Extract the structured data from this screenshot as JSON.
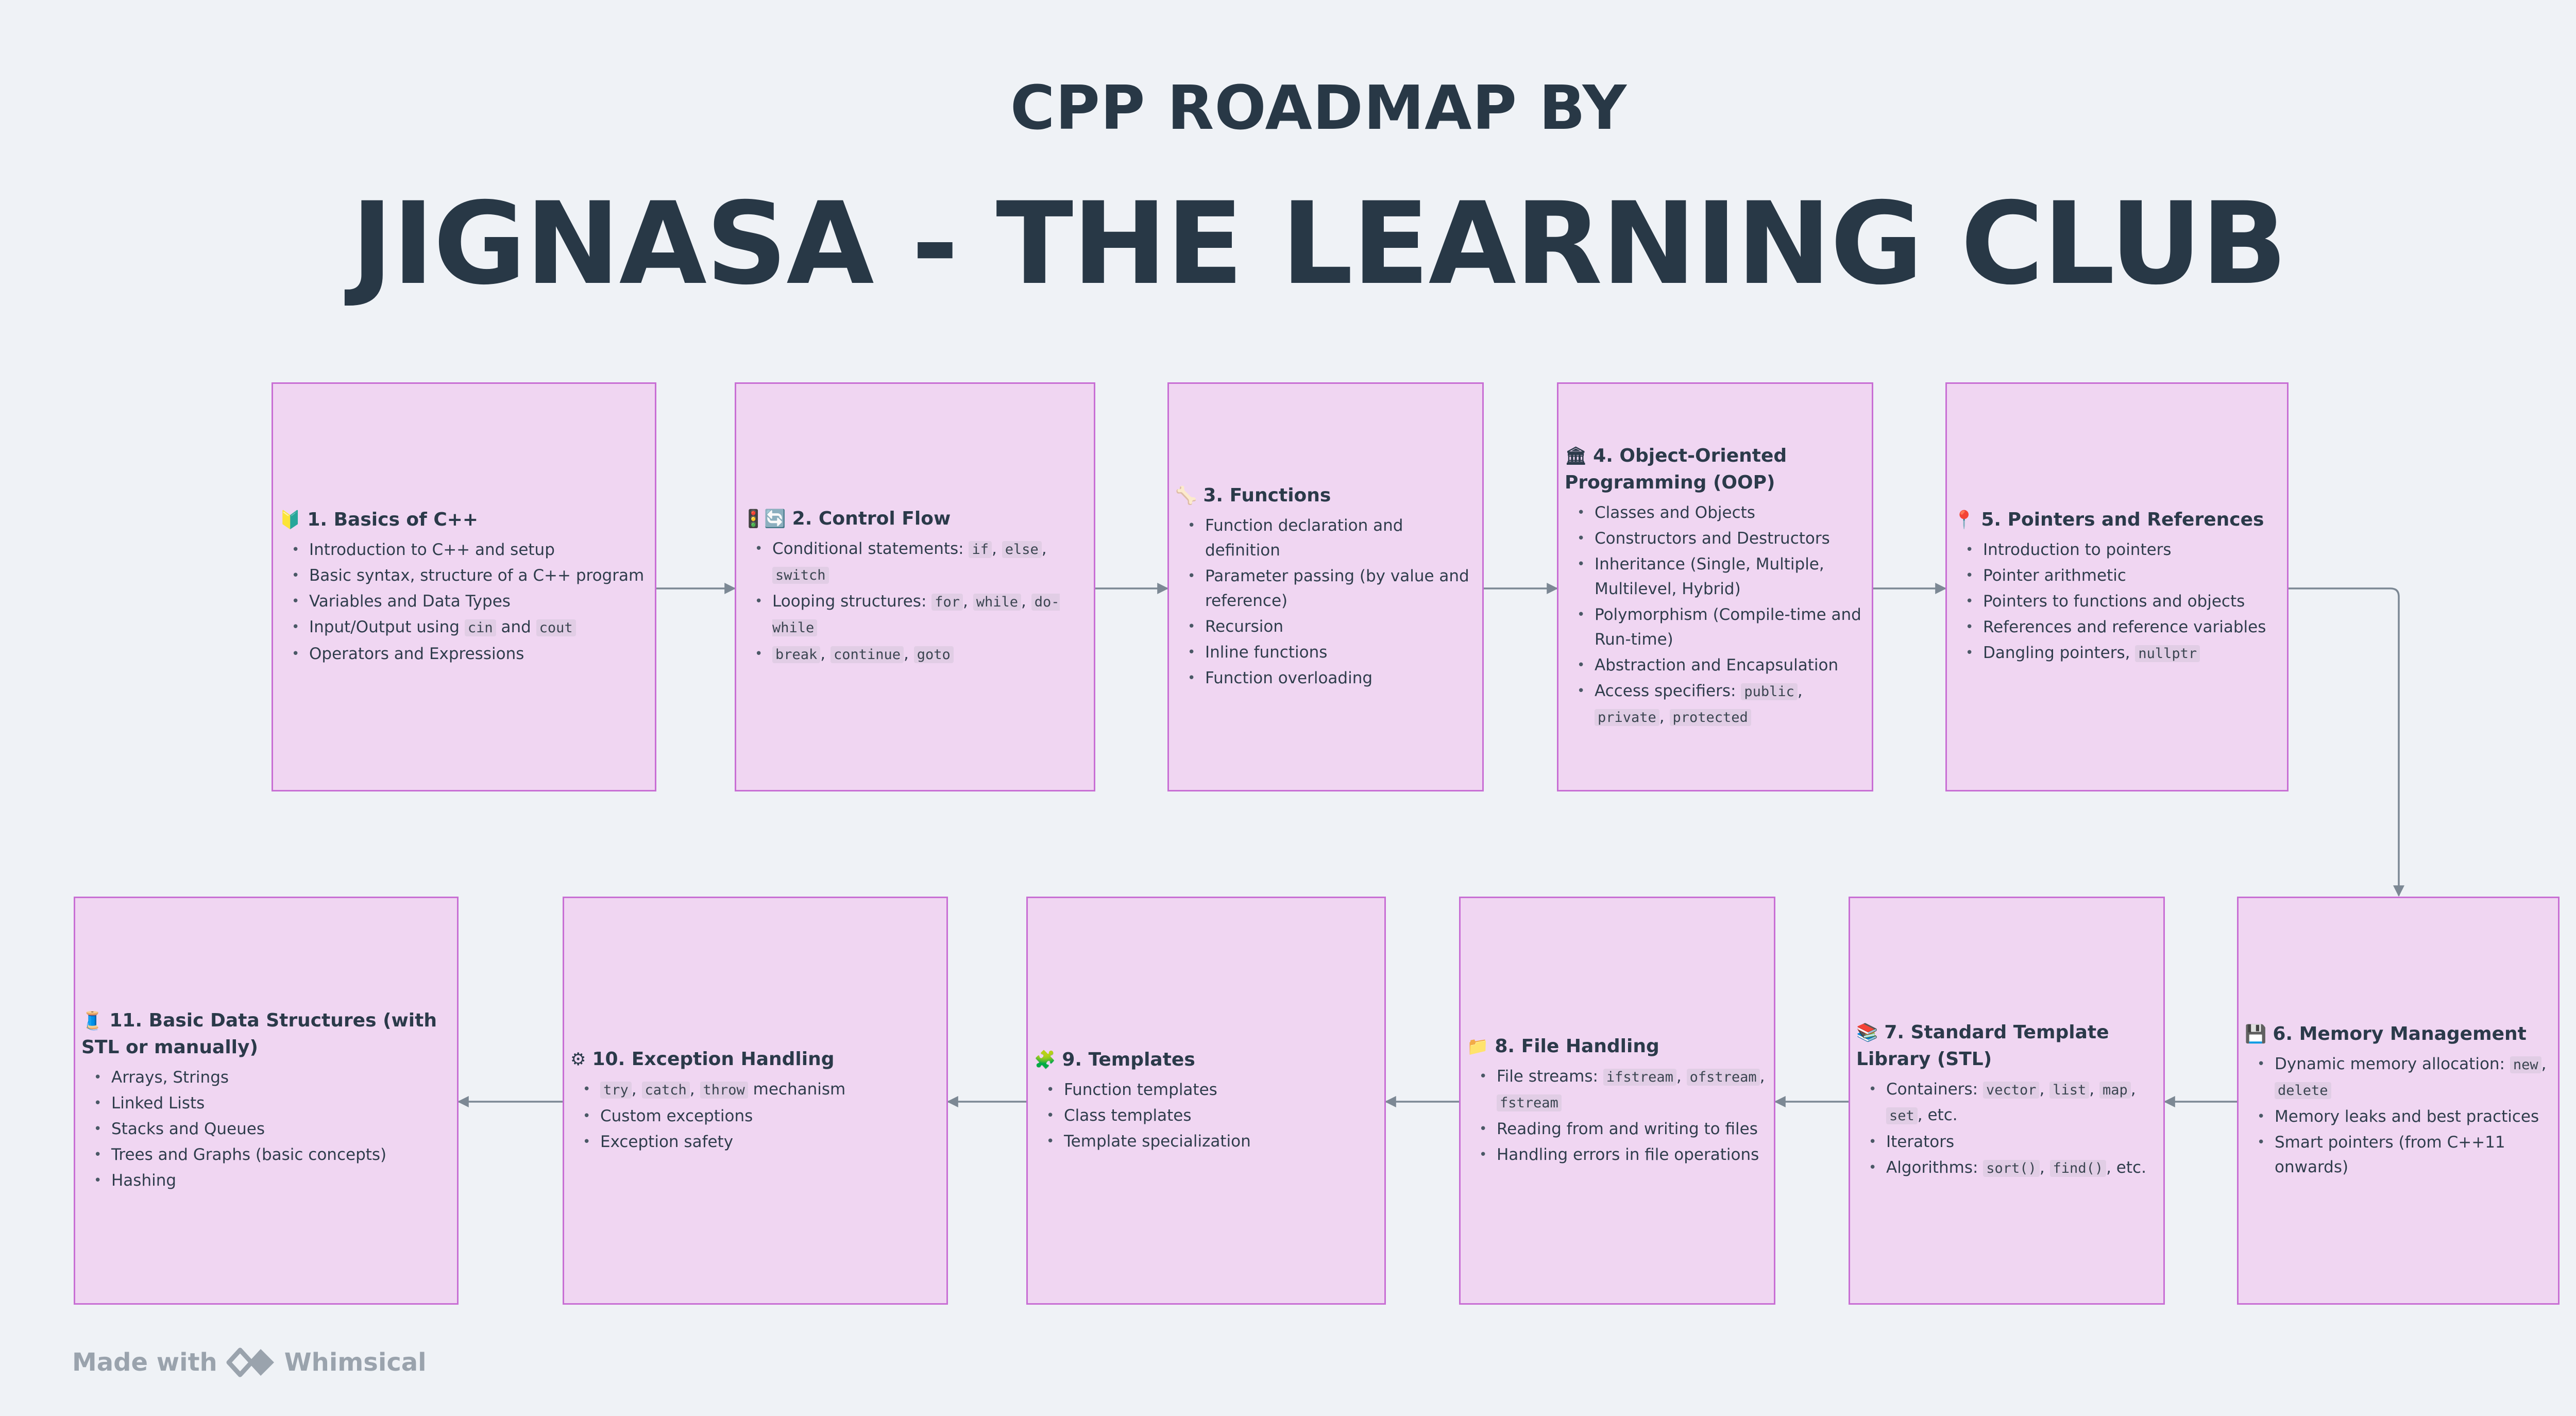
{
  "header": {
    "line1": "CPP ROADMAP BY",
    "line2": "JIGNASA - THE LEARNING CLUB"
  },
  "colors": {
    "box_fill": "#f0d6f2",
    "box_border": "#c86fd4",
    "arrow": "#7c8894",
    "title": "#283846"
  },
  "boxes": [
    {
      "title": "1. Basics of C++",
      "icon": "beginner-icon",
      "glyph": "🔰",
      "items": [
        [
          {
            "t": "Introduction to C++ and setup"
          }
        ],
        [
          {
            "t": "Basic syntax, structure of a C++ program"
          }
        ],
        [
          {
            "t": "Variables and Data Types"
          }
        ],
        [
          {
            "t": "Input/Output using "
          },
          {
            "c": "cin"
          },
          {
            "t": " and "
          },
          {
            "c": "cout"
          }
        ],
        [
          {
            "t": "Operators and Expressions"
          }
        ]
      ]
    },
    {
      "title": "2. Control Flow",
      "icon": "control-flow-icon",
      "glyph": "🚦🔄",
      "items": [
        [
          {
            "t": "Conditional statements: "
          },
          {
            "c": "if"
          },
          {
            "t": ", "
          },
          {
            "c": "else"
          },
          {
            "t": ", "
          },
          {
            "c": "switch"
          }
        ],
        [
          {
            "t": "Looping structures: "
          },
          {
            "c": "for"
          },
          {
            "t": ", "
          },
          {
            "c": "while"
          },
          {
            "t": ", "
          },
          {
            "c": "do-while"
          }
        ],
        [
          {
            "c": "break"
          },
          {
            "t": ", "
          },
          {
            "c": "continue"
          },
          {
            "t": ", "
          },
          {
            "c": "goto"
          }
        ]
      ]
    },
    {
      "title": "3. Functions",
      "icon": "bone-icon",
      "glyph": "🦴",
      "items": [
        [
          {
            "t": "Function declaration and definition"
          }
        ],
        [
          {
            "t": "Parameter passing (by value and reference)"
          }
        ],
        [
          {
            "t": "Recursion"
          }
        ],
        [
          {
            "t": "Inline functions"
          }
        ],
        [
          {
            "t": "Function overloading"
          }
        ]
      ]
    },
    {
      "title": "4. Object-Oriented Programming (OOP)",
      "icon": "classical-building-icon",
      "glyph": "🏛",
      "items": [
        [
          {
            "t": "Classes and Objects"
          }
        ],
        [
          {
            "t": "Constructors and Destructors"
          }
        ],
        [
          {
            "t": "Inheritance (Single, Multiple, Multilevel, Hybrid)"
          }
        ],
        [
          {
            "t": "Polymorphism (Compile-time and Run-time)"
          }
        ],
        [
          {
            "t": "Abstraction and Encapsulation"
          }
        ],
        [
          {
            "t": "Access specifiers: "
          },
          {
            "c": "public"
          },
          {
            "t": ", "
          },
          {
            "c": "private"
          },
          {
            "t": ", "
          },
          {
            "c": "protected"
          }
        ]
      ]
    },
    {
      "title": "5. Pointers and References",
      "icon": "pushpin-icon",
      "glyph": "📍",
      "items": [
        [
          {
            "t": "Introduction to pointers"
          }
        ],
        [
          {
            "t": "Pointer arithmetic"
          }
        ],
        [
          {
            "t": "Pointers to functions and objects"
          }
        ],
        [
          {
            "t": "References and reference variables"
          }
        ],
        [
          {
            "t": "Dangling pointers, "
          },
          {
            "c": "nullptr"
          }
        ]
      ]
    },
    {
      "title": "6. Memory Management",
      "icon": "floppy-disk-icon",
      "glyph": "💾",
      "items": [
        [
          {
            "t": "Dynamic memory allocation: "
          },
          {
            "c": "new"
          },
          {
            "t": ", "
          },
          {
            "c": "delete"
          }
        ],
        [
          {
            "t": "Memory leaks and best practices"
          }
        ],
        [
          {
            "t": "Smart pointers (from C++11 onwards)"
          }
        ]
      ]
    },
    {
      "title": "7. Standard Template Library (STL)",
      "icon": "books-icon",
      "glyph": "📚",
      "items": [
        [
          {
            "t": "Containers: "
          },
          {
            "c": "vector"
          },
          {
            "t": ", "
          },
          {
            "c": "list"
          },
          {
            "t": ", "
          },
          {
            "c": "map"
          },
          {
            "t": ", "
          },
          {
            "c": "set"
          },
          {
            "t": ", etc."
          }
        ],
        [
          {
            "t": "Iterators"
          }
        ],
        [
          {
            "t": "Algorithms: "
          },
          {
            "c": "sort()"
          },
          {
            "t": ", "
          },
          {
            "c": "find()"
          },
          {
            "t": ", etc."
          }
        ]
      ]
    },
    {
      "title": "8. File Handling",
      "icon": "folder-icon",
      "glyph": "📁",
      "items": [
        [
          {
            "t": "File streams: "
          },
          {
            "c": "ifstream"
          },
          {
            "t": ", "
          },
          {
            "c": "ofstream"
          },
          {
            "t": ", "
          },
          {
            "c": "fstream"
          }
        ],
        [
          {
            "t": "Reading from and writing to files"
          }
        ],
        [
          {
            "t": "Handling errors in file operations"
          }
        ]
      ]
    },
    {
      "title": "9. Templates",
      "icon": "puzzle-icon",
      "glyph": "🧩",
      "items": [
        [
          {
            "t": "Function templates"
          }
        ],
        [
          {
            "t": "Class templates"
          }
        ],
        [
          {
            "t": "Template specialization"
          }
        ]
      ]
    },
    {
      "title": "10. Exception Handling",
      "icon": "gear-icon",
      "glyph": "⚙",
      "items": [
        [
          {
            "c": "try"
          },
          {
            "t": ", "
          },
          {
            "c": "catch"
          },
          {
            "t": ", "
          },
          {
            "c": "throw"
          },
          {
            "t": " mechanism"
          }
        ],
        [
          {
            "t": "Custom exceptions"
          }
        ],
        [
          {
            "t": "Exception safety"
          }
        ]
      ]
    },
    {
      "title": "11. Basic Data Structures (with STL or manually)",
      "icon": "thread-spool-icon",
      "glyph": "🧵",
      "items": [
        [
          {
            "t": "Arrays, Strings"
          }
        ],
        [
          {
            "t": "Linked Lists"
          }
        ],
        [
          {
            "t": "Stacks and Queues"
          }
        ],
        [
          {
            "t": "Trees and Graphs (basic concepts)"
          }
        ],
        [
          {
            "t": "Hashing"
          }
        ]
      ]
    }
  ],
  "footer": {
    "made_with": "Made with",
    "brand": "Whimsical",
    "icon": "whimsical-logo-icon"
  }
}
